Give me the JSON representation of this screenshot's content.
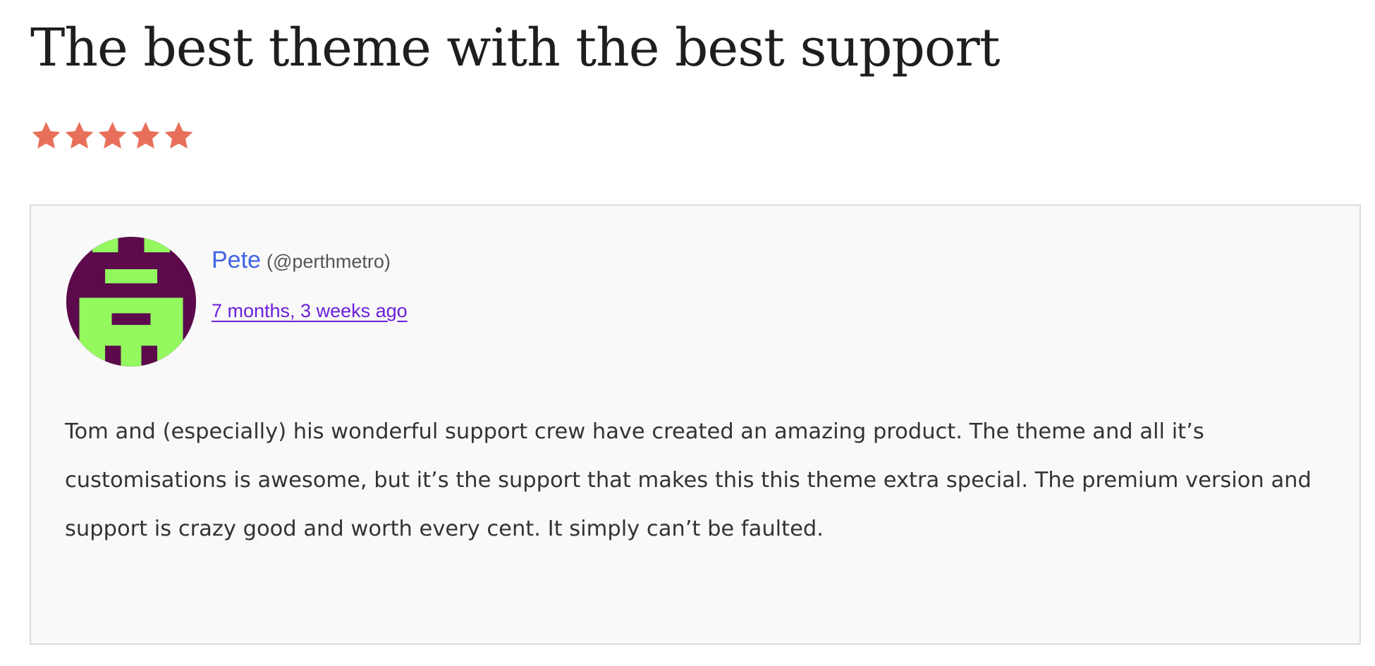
{
  "review": {
    "title": "The best theme with the best support",
    "rating": {
      "value": 5,
      "max": 5,
      "color": "#e8705a"
    },
    "author": {
      "name": "Pete",
      "handle": "(@perthmetro)",
      "avatar_icon": "identicon-avatar",
      "avatar_colors": {
        "background": "#5c0a4c",
        "foreground": "#93f95f"
      }
    },
    "date": "7 months, 3 weeks ago",
    "body": "Tom and (especially) his wonderful support crew have created an amazing product. The theme and all it’s customisations is awesome, but it’s the support that makes this this theme extra special. The premium version and support is crazy good and worth every cent. It simply can’t be faulted."
  }
}
